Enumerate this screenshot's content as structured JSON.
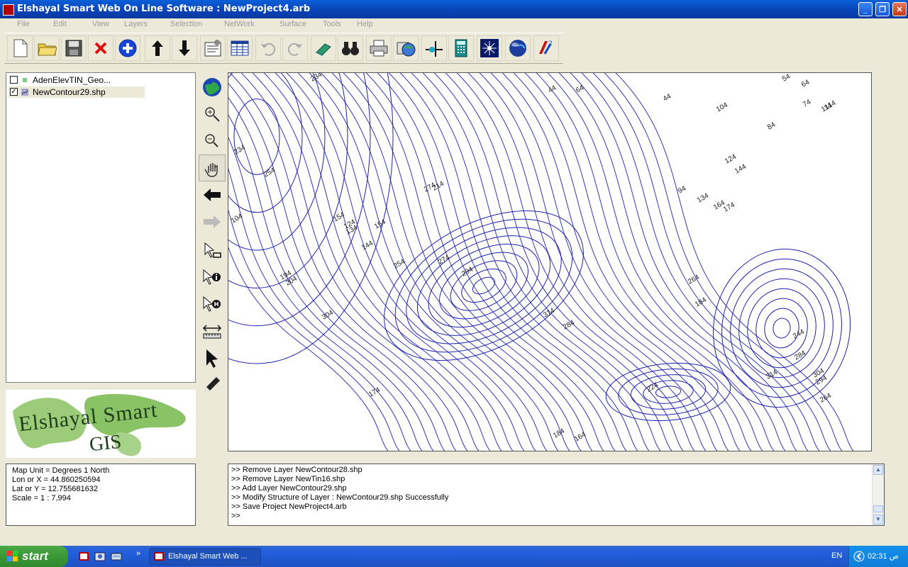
{
  "window": {
    "title": "Elshayal Smart Web On Line Software : NewProject4.arb",
    "min_label": "_",
    "max_label": "❐",
    "close_label": "✕"
  },
  "menu": [
    "File",
    "Edit",
    "View",
    "Layers",
    "Selection",
    "NetWork",
    "Surface",
    "Tools",
    "Help"
  ],
  "toolbar_icons": [
    "new-file-icon",
    "open-folder-icon",
    "save-icon",
    "delete-icon",
    "add-icon",
    "move-up-icon",
    "move-down-icon",
    "properties-icon",
    "attribute-table-icon",
    "undo-icon",
    "redo-icon",
    "eraser-icon",
    "binoculars-icon",
    "print-icon",
    "map-export-icon",
    "coordinate-icon",
    "calculator-icon",
    "star-map-icon",
    "globe-icon",
    "3d-icon"
  ],
  "layers": [
    {
      "name": "AdenElevTIN_Geo...",
      "checked": false,
      "check_mark": ""
    },
    {
      "name": "NewContour29.shp",
      "checked": true,
      "check_mark": "✓"
    }
  ],
  "logo": {
    "line1": "Elshayal Smart",
    "line2": "GIS"
  },
  "side_tools": [
    "full-extent-icon",
    "zoom-in-icon",
    "zoom-out-icon",
    "pan-icon",
    "back-icon",
    "forward-icon",
    "select-rect-icon",
    "identify-icon",
    "hyperlink-icon",
    "measure-icon",
    "pointer-icon",
    "edit-pencil-icon"
  ],
  "map": {
    "contour_color": "#1f1fb0",
    "labels": [
      "234",
      "44",
      "64",
      "44",
      "54",
      "64",
      "74",
      "114",
      "104",
      "84",
      "124",
      "144",
      "94",
      "134",
      "164",
      "174",
      "194",
      "204",
      "214",
      "254",
      "274",
      "294",
      "304",
      "314",
      "284",
      "264",
      "154",
      "124",
      "134",
      "144",
      "154",
      "174",
      "184",
      "164",
      "224",
      "244",
      "284",
      "314",
      "304",
      "294",
      "264",
      "254",
      "234",
      "104",
      "184",
      "274",
      "114"
    ]
  },
  "info": {
    "map_unit": "Map Unit = Degrees 1 North",
    "lon": "Lon or X   = 44.860250594",
    "lat": "Lat or Y   = 12.755681632",
    "scale": "Scale      = 1 : 7,994"
  },
  "log": [
    ">>  Remove Layer NewContour28.shp",
    ">>  Remove Layer NewTin16.shp",
    ">>  Add Layer NewContour29.shp",
    ">>  Modify Structure of Layer : NewContour29.shp Successfully",
    ">>  Save Project NewProject4.arb",
    ">>"
  ],
  "scroll": {
    "up": "▲",
    "down": "▼"
  },
  "taskbar": {
    "start_label": "start",
    "task_label": "Elshayal Smart Web ...",
    "language": "EN",
    "clock": "02:31 ص",
    "expand": "»"
  }
}
